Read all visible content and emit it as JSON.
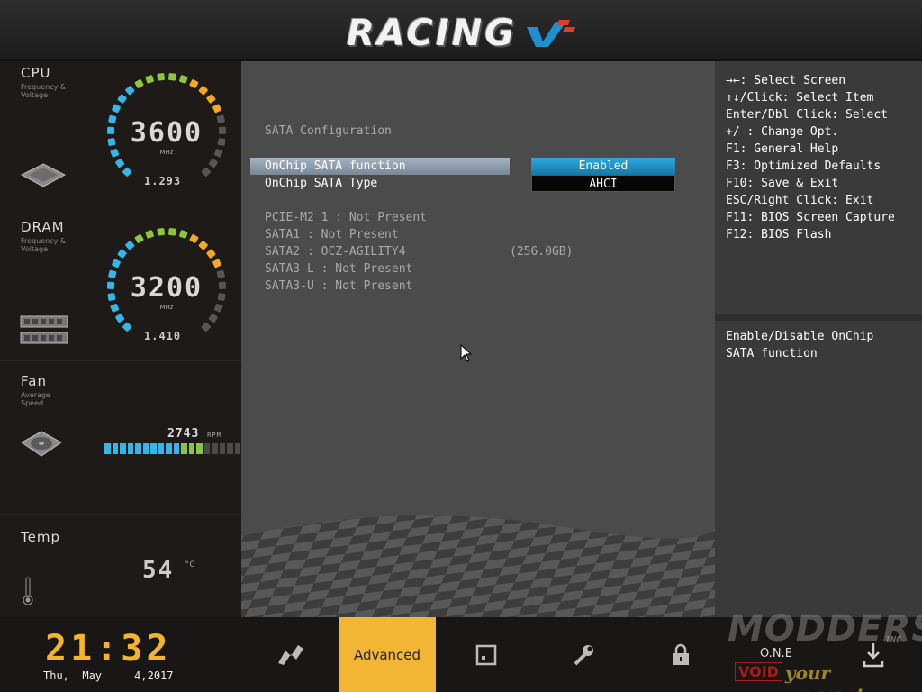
{
  "header": {
    "logo_text": "RACING"
  },
  "sidebar": {
    "cpu": {
      "title": "CPU",
      "subtitle": "Frequency & Voltage",
      "value": "3600",
      "unit": "MHz",
      "voltage": "1.293"
    },
    "dram": {
      "title": "DRAM",
      "subtitle": "Frequency & Voltage",
      "value": "3200",
      "unit": "MHz",
      "voltage": "1.410"
    },
    "fan": {
      "title": "Fan",
      "subtitle": "Average Speed",
      "rpm": "2743",
      "rpm_unit": "RPM",
      "level_fraction": 0.64
    },
    "temp": {
      "title": "Temp",
      "value": "54",
      "unit": "°C"
    }
  },
  "main": {
    "section_title": "SATA Configuration",
    "settings": [
      {
        "label": "OnChip SATA function",
        "value": "Enabled"
      },
      {
        "label": "OnChip SATA Type",
        "value": "AHCI"
      }
    ],
    "ports": [
      {
        "text": "PCIE-M2_1 : Not Present",
        "size": ""
      },
      {
        "text": "SATA1 : Not Present",
        "size": ""
      },
      {
        "text": "SATA2 : OCZ-AGILITY4",
        "size": "(256.0GB)"
      },
      {
        "text": "SATA3-L : Not Present",
        "size": ""
      },
      {
        "text": "SATA3-U : Not Present",
        "size": ""
      }
    ]
  },
  "help": {
    "keys": [
      "→←: Select Screen",
      "↑↓/Click: Select Item",
      "Enter/Dbl Click: Select",
      "+/-: Change Opt.",
      "F1: General Help",
      "F3: Optimized Defaults",
      "F10: Save & Exit",
      "ESC/Right Click: Exit",
      "F11: BIOS Screen Capture",
      "F12: BIOS Flash"
    ],
    "description": [
      "Enable/Disable OnChip",
      "SATA function"
    ]
  },
  "bottom": {
    "time": "21:32",
    "date": "Thu,  May     4,2017",
    "tabs": [
      {
        "id": "main",
        "label": "",
        "icon": "flag-icon"
      },
      {
        "id": "advanced",
        "label": "Advanced",
        "icon": ""
      },
      {
        "id": "tools",
        "label": "",
        "icon": "chip-icon"
      },
      {
        "id": "oc",
        "label": "",
        "icon": "wrench-icon"
      },
      {
        "id": "security",
        "label": "",
        "icon": "lock-icon"
      },
      {
        "id": "exit",
        "label": "",
        "icon": "exit-icon"
      }
    ],
    "watermark": {
      "brand": "MODDERS",
      "inc": "INC.",
      "one": "O.N.E",
      "void": "VOID",
      "tagline": "your warranty"
    }
  },
  "colors": {
    "accent": "#f3b534",
    "selected_value": "#1e90c8",
    "gauge_blue": "#35b6ea",
    "gauge_green": "#8cc63f",
    "gauge_orange": "#f7a823"
  }
}
